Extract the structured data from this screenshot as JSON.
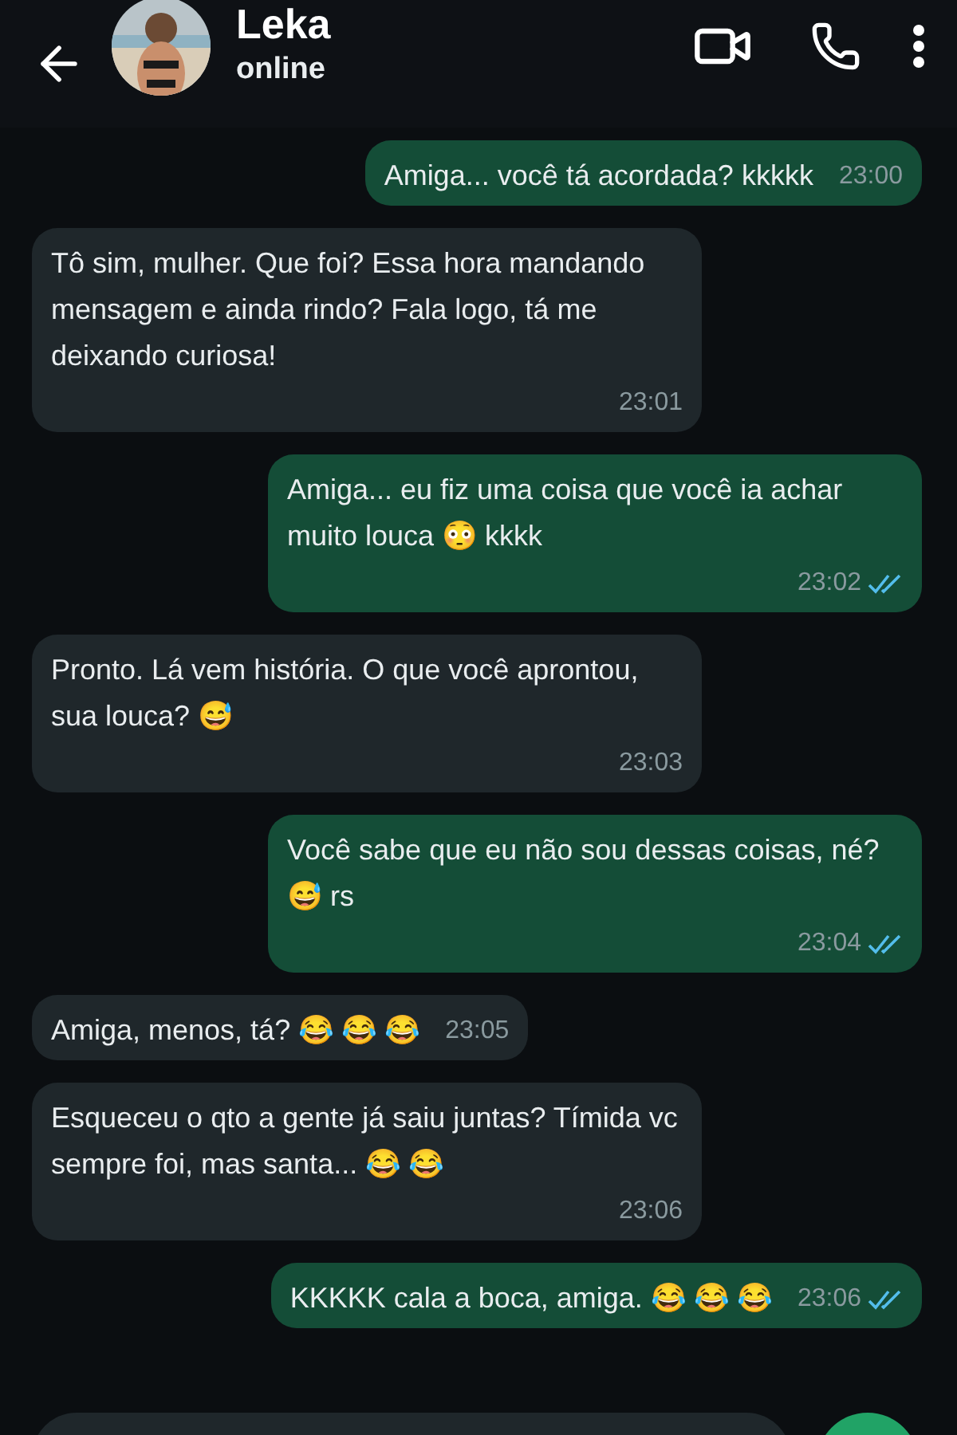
{
  "header": {
    "name": "Leka",
    "status": "online"
  },
  "messages": [
    {
      "kind": "out",
      "text": "Amiga... você tá acordada? kkkkk",
      "time": "23:00",
      "read": false
    },
    {
      "kind": "in",
      "text": "Tô sim, mulher. Que foi? Essa hora mandando mensagem e ainda rindo? Fala logo, tá me deixando curiosa!",
      "time": "23:01"
    },
    {
      "kind": "out",
      "text": "Amiga... eu fiz uma coisa que você ia achar muito louca 😳 kkkk",
      "time": "23:02",
      "read": true
    },
    {
      "kind": "in",
      "text": "Pronto. Lá vem história. O que você aprontou, sua louca? 😅",
      "time": "23:03"
    },
    {
      "kind": "out",
      "text": "Você sabe que eu não sou dessas coisas, né? 😅 rs",
      "time": "23:04",
      "read": true
    },
    {
      "kind": "in",
      "text": "Amiga, menos, tá? 😂 😂 😂",
      "time": "23:05"
    },
    {
      "kind": "in",
      "text": "Esqueceu o qto a gente já saiu juntas? Tímida vc sempre foi, mas santa... 😂 😂",
      "time": "23:06"
    },
    {
      "kind": "out",
      "text": "KKKKK cala a boca, amiga. 😂 😂 😂",
      "time": "23:06",
      "read": true
    }
  ]
}
